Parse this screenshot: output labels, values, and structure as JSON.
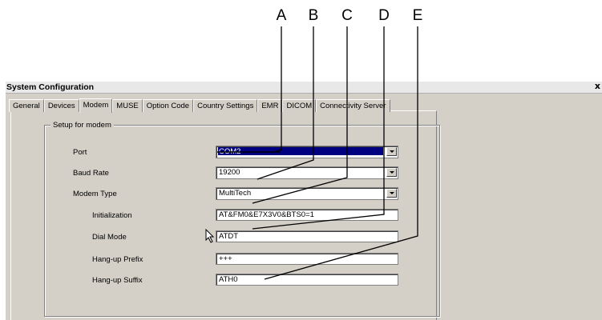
{
  "callouts": [
    "A",
    "B",
    "C",
    "D",
    "E"
  ],
  "window": {
    "title": "System Configuration",
    "close_label": "x"
  },
  "tabs": [
    {
      "label": "General",
      "active": false
    },
    {
      "label": "Devices",
      "active": false
    },
    {
      "label": "Modem",
      "active": true
    },
    {
      "label": "MUSE",
      "active": false
    },
    {
      "label": "Option Code",
      "active": false
    },
    {
      "label": "Country Settings",
      "active": false
    },
    {
      "label": "EMR",
      "active": false
    },
    {
      "label": "DICOM",
      "active": false
    },
    {
      "label": "Connectivity Server",
      "active": false
    }
  ],
  "group": {
    "title": "Setup for modem",
    "port": {
      "label": "Port",
      "value": "COM2"
    },
    "baud_rate": {
      "label": "Baud Rate",
      "value": "19200"
    },
    "modem_type": {
      "label": "Modem Type",
      "value": "MultiTech"
    },
    "initialization": {
      "label": "Initialization",
      "value": "AT&FM0&E7X3V0&BTS0=1"
    },
    "dial_mode": {
      "label": "Dial Mode",
      "value": "ATDT"
    },
    "hangup_prefix": {
      "label": "Hang-up Prefix",
      "value": "+++"
    },
    "hangup_suffix": {
      "label": "Hang-up Suffix",
      "value": "ATH0"
    }
  },
  "colors": {
    "dialog_face": "#d4d0c8",
    "selection": "#000080"
  },
  "icons": [
    "chevron-down-icon",
    "mouse-pointer-icon",
    "close-icon"
  ]
}
